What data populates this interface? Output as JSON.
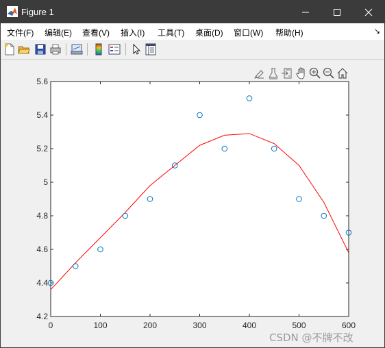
{
  "window": {
    "title": "Figure 1",
    "accent": "#3b3b3b"
  },
  "menu": {
    "items": [
      "文件(F)",
      "编辑(E)",
      "查看(V)",
      "插入(I)",
      "工具(T)",
      "桌面(D)",
      "窗口(W)",
      "帮助(H)"
    ],
    "overflow_icon": "dock-arrow-icon"
  },
  "toolbar": {
    "icons": [
      "new-figure-icon",
      "open-file-icon",
      "save-icon",
      "print-icon",
      "link-plot-icon",
      "insert-colorbar-icon",
      "insert-legend-icon",
      "edit-plot-icon",
      "property-inspector-icon"
    ]
  },
  "axes_toolbar": {
    "icons": [
      "brush-icon",
      "data-tips-icon",
      "export-icon",
      "pan-icon",
      "zoom-in-icon",
      "zoom-out-icon",
      "home-icon"
    ]
  },
  "chart_data": {
    "type": "scatter",
    "title": "",
    "xlabel": "",
    "ylabel": "",
    "xlim": [
      0,
      600
    ],
    "ylim": [
      4.2,
      5.6
    ],
    "grid": false,
    "x_ticks": [
      "0",
      "100",
      "200",
      "300",
      "400",
      "500",
      "600"
    ],
    "y_ticks": [
      "4.2",
      "4.4",
      "4.6",
      "4.8",
      "5",
      "5.2",
      "5.4",
      "5.6"
    ],
    "series": [
      {
        "type": "scatter",
        "marker": "circle",
        "color": "#0072bd",
        "x": [
          0,
          50,
          100,
          150,
          200,
          250,
          300,
          350,
          400,
          450,
          500,
          550,
          600
        ],
        "y": [
          4.4,
          4.5,
          4.6,
          4.8,
          4.9,
          5.1,
          5.4,
          5.2,
          5.5,
          5.2,
          4.9,
          4.8,
          4.7
        ]
      },
      {
        "type": "line",
        "color": "#ff0000",
        "x": [
          0,
          50,
          100,
          150,
          200,
          250,
          300,
          350,
          400,
          450,
          500,
          550,
          600
        ],
        "y": [
          4.36,
          4.52,
          4.67,
          4.82,
          4.98,
          5.1,
          5.22,
          5.28,
          5.29,
          5.23,
          5.1,
          4.88,
          4.58
        ]
      }
    ]
  },
  "watermark": "CSDN @不牌不改"
}
